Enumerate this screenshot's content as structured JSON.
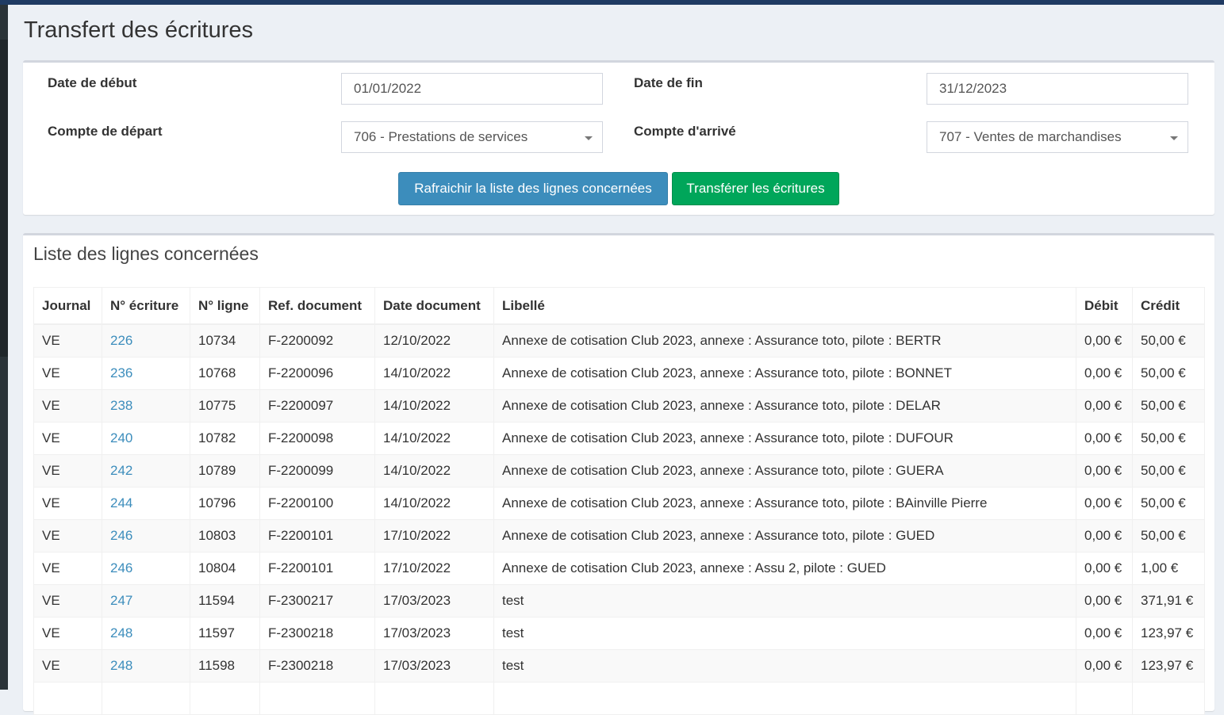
{
  "page": {
    "title": "Transfert des écritures"
  },
  "form": {
    "date_debut_label": "Date de début",
    "date_debut_value": "01/01/2022",
    "date_fin_label": "Date de fin",
    "date_fin_value": "31/12/2023",
    "compte_depart_label": "Compte de départ",
    "compte_depart_value": "706 - Prestations de services",
    "compte_arrive_label": "Compte d'arrivé",
    "compte_arrive_value": "707 - Ventes de marchandises",
    "refresh_button": "Rafraichir la liste des lignes concernées",
    "transfer_button": "Transférer les écritures"
  },
  "list": {
    "title": "Liste des lignes concernées",
    "columns": [
      "Journal",
      "N° écriture",
      "N° ligne",
      "Ref. document",
      "Date document",
      "Libellé",
      "Débit",
      "Crédit"
    ],
    "rows": [
      {
        "journal": "VE",
        "ecriture": "226",
        "ligne": "10734",
        "ref": "F-2200092",
        "date": "12/10/2022",
        "libelle": "Annexe de cotisation Club 2023, annexe : Assurance toto, pilote : BERTR",
        "debit": "0,00 €",
        "credit": "50,00 €"
      },
      {
        "journal": "VE",
        "ecriture": "236",
        "ligne": "10768",
        "ref": "F-2200096",
        "date": "14/10/2022",
        "libelle": "Annexe de cotisation Club 2023, annexe : Assurance toto, pilote : BONNET",
        "debit": "0,00 €",
        "credit": "50,00 €"
      },
      {
        "journal": "VE",
        "ecriture": "238",
        "ligne": "10775",
        "ref": "F-2200097",
        "date": "14/10/2022",
        "libelle": "Annexe de cotisation Club 2023, annexe : Assurance toto, pilote : DELAR",
        "debit": "0,00 €",
        "credit": "50,00 €"
      },
      {
        "journal": "VE",
        "ecriture": "240",
        "ligne": "10782",
        "ref": "F-2200098",
        "date": "14/10/2022",
        "libelle": "Annexe de cotisation Club 2023, annexe : Assurance toto, pilote : DUFOUR",
        "debit": "0,00 €",
        "credit": "50,00 €"
      },
      {
        "journal": "VE",
        "ecriture": "242",
        "ligne": "10789",
        "ref": "F-2200099",
        "date": "14/10/2022",
        "libelle": "Annexe de cotisation Club 2023, annexe : Assurance toto, pilote : GUERA",
        "debit": "0,00 €",
        "credit": "50,00 €"
      },
      {
        "journal": "VE",
        "ecriture": "244",
        "ligne": "10796",
        "ref": "F-2200100",
        "date": "14/10/2022",
        "libelle": "Annexe de cotisation Club 2023, annexe : Assurance toto, pilote : BAinville Pierre",
        "debit": "0,00 €",
        "credit": "50,00 €"
      },
      {
        "journal": "VE",
        "ecriture": "246",
        "ligne": "10803",
        "ref": "F-2200101",
        "date": "17/10/2022",
        "libelle": "Annexe de cotisation Club 2023, annexe : Assurance toto, pilote : GUED",
        "debit": "0,00 €",
        "credit": "50,00 €"
      },
      {
        "journal": "VE",
        "ecriture": "246",
        "ligne": "10804",
        "ref": "F-2200101",
        "date": "17/10/2022",
        "libelle": "Annexe de cotisation Club 2023, annexe : Assu 2, pilote : GUED",
        "debit": "0,00 €",
        "credit": "1,00 €"
      },
      {
        "journal": "VE",
        "ecriture": "247",
        "ligne": "11594",
        "ref": "F-2300217",
        "date": "17/03/2023",
        "libelle": "test",
        "debit": "0,00 €",
        "credit": "371,91 €"
      },
      {
        "journal": "VE",
        "ecriture": "248",
        "ligne": "11597",
        "ref": "F-2300218",
        "date": "17/03/2023",
        "libelle": "test",
        "debit": "0,00 €",
        "credit": "123,97 €"
      },
      {
        "journal": "VE",
        "ecriture": "248",
        "ligne": "11598",
        "ref": "F-2300218",
        "date": "17/03/2023",
        "libelle": "test",
        "debit": "0,00 €",
        "credit": "123,97 €"
      },
      {
        "journal": "",
        "ecriture": "",
        "ligne": "",
        "ref": "",
        "date": "",
        "libelle": "",
        "debit": "",
        "credit": ""
      }
    ]
  },
  "colors": {
    "primary": "#3c8dbc",
    "success": "#00a65a",
    "topbar": "#1f3b63",
    "background": "#ecf0f5"
  }
}
